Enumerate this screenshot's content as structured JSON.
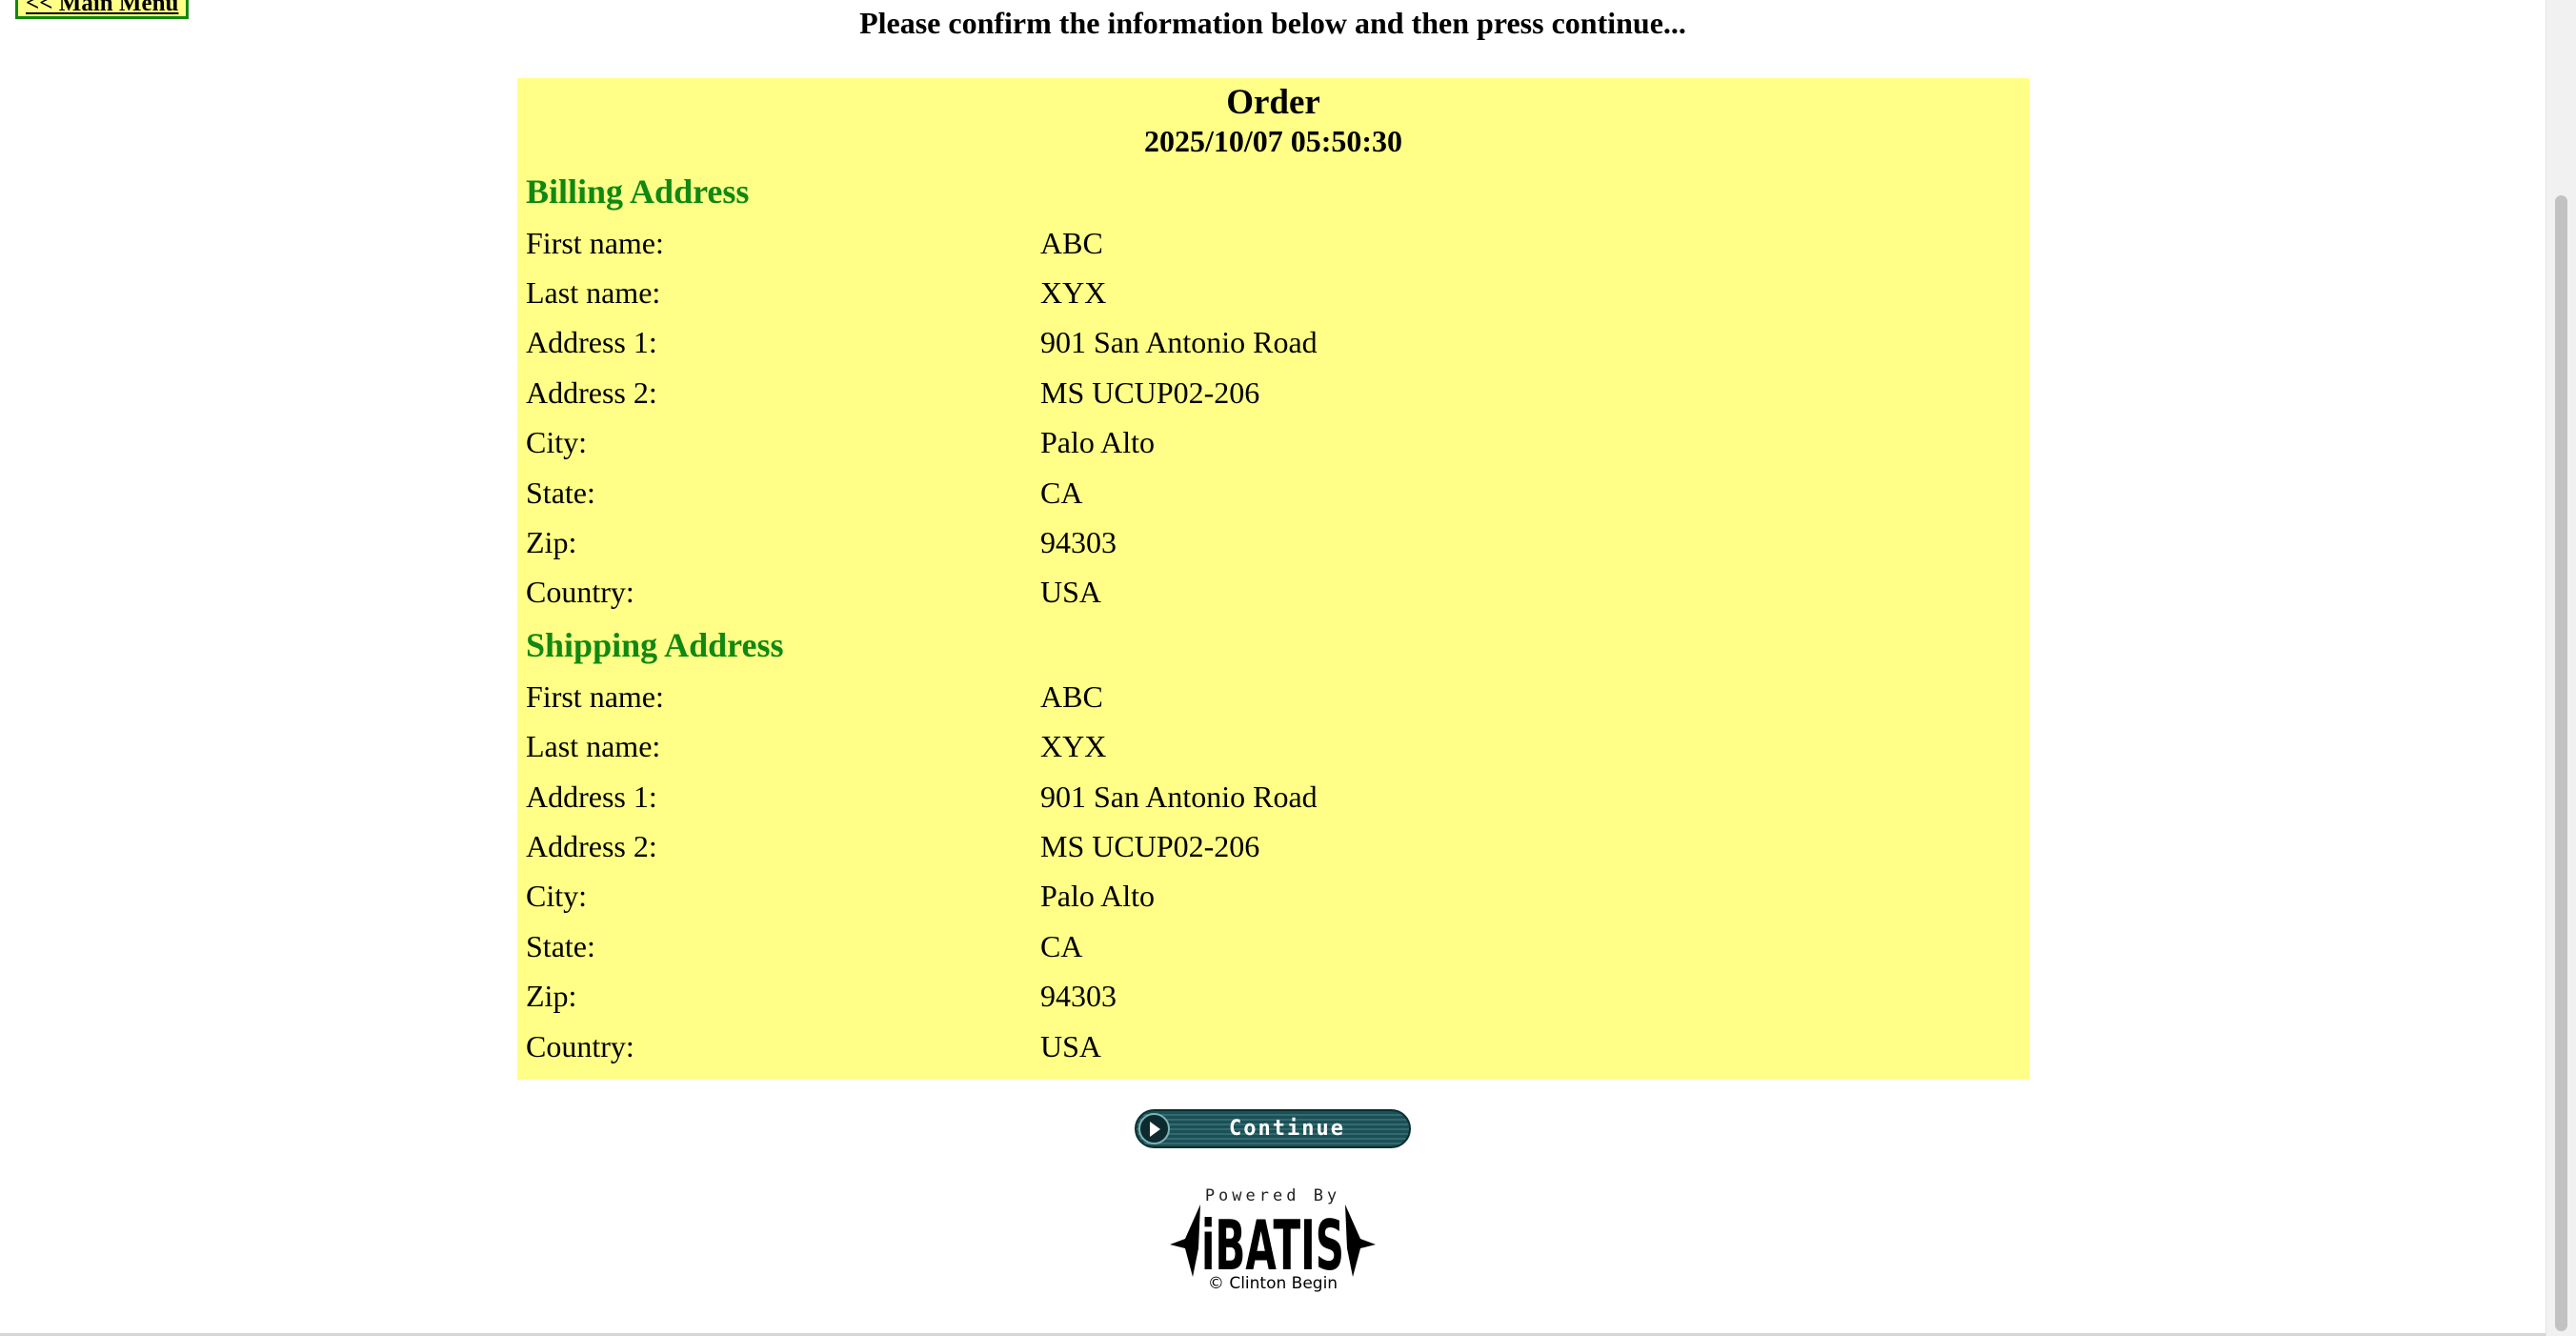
{
  "nav": {
    "main_menu_label": "<< Main Menu"
  },
  "prompt": "Please confirm the information below and then press continue...",
  "order": {
    "title": "Order",
    "datetime": "2025/10/07 05:50:30",
    "billing": {
      "heading": "Billing Address",
      "fields": [
        {
          "label": "First name:",
          "value": "ABC"
        },
        {
          "label": "Last name:",
          "value": "XYX"
        },
        {
          "label": "Address 1:",
          "value": "901 San Antonio Road"
        },
        {
          "label": "Address 2:",
          "value": "MS UCUP02-206"
        },
        {
          "label": "City:",
          "value": "Palo Alto"
        },
        {
          "label": "State:",
          "value": "CA"
        },
        {
          "label": "Zip:",
          "value": "94303"
        },
        {
          "label": "Country:",
          "value": "USA"
        }
      ]
    },
    "shipping": {
      "heading": "Shipping Address",
      "fields": [
        {
          "label": "First name:",
          "value": "ABC"
        },
        {
          "label": "Last name:",
          "value": "XYX"
        },
        {
          "label": "Address 1:",
          "value": "901 San Antonio Road"
        },
        {
          "label": "Address 2:",
          "value": "MS UCUP02-206"
        },
        {
          "label": "City:",
          "value": "Palo Alto"
        },
        {
          "label": "State:",
          "value": "CA"
        },
        {
          "label": "Zip:",
          "value": "94303"
        },
        {
          "label": "Country:",
          "value": "USA"
        }
      ]
    }
  },
  "continue_button": {
    "label": "Continue",
    "icon": "play-arrow-icon"
  },
  "footer": {
    "powered_by": "Powered By",
    "logo_text": "iBATIS",
    "credit": "© Clinton Begin"
  },
  "colors": {
    "panel_background": "#ffff88",
    "heading_green": "#118811",
    "button_teal": "#1e4f55"
  }
}
